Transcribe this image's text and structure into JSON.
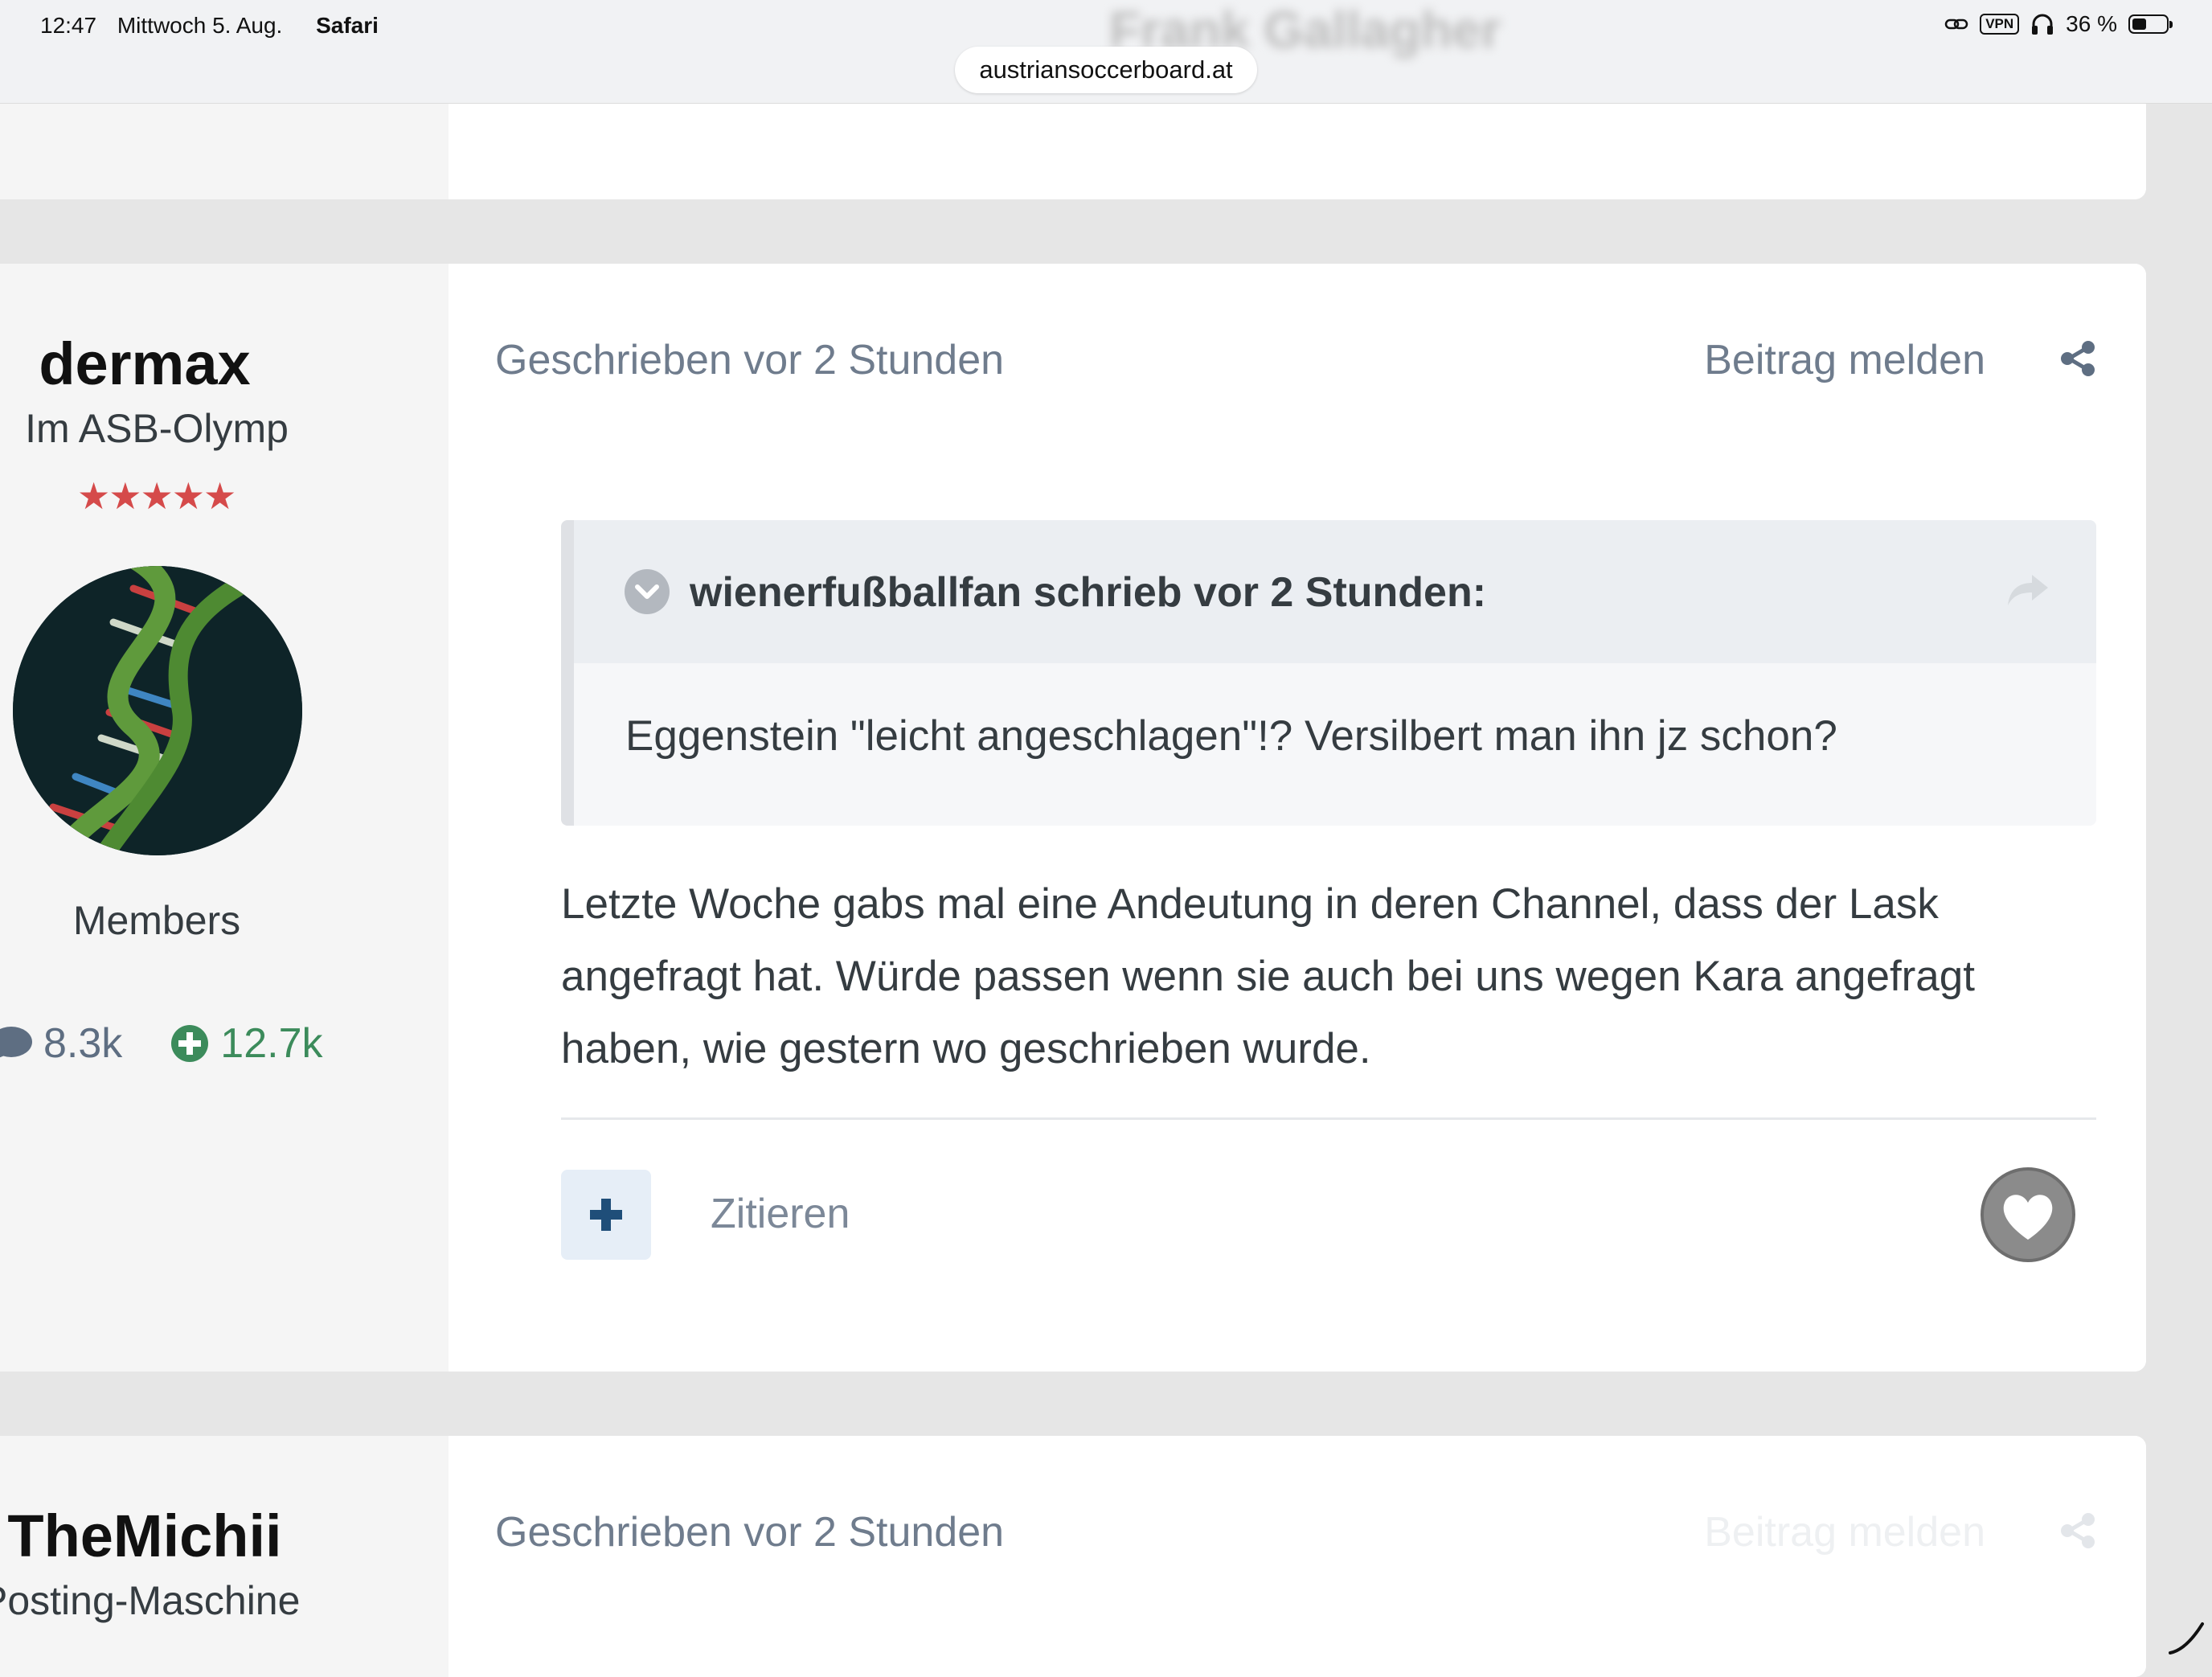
{
  "status_bar": {
    "time": "12:47",
    "date": "Mittwoch 5. Aug.",
    "app": "Safari",
    "vpn": "VPN",
    "battery": "36 %"
  },
  "browser": {
    "url": "austriansoccerboard.at",
    "ghost_title": "Frank Gallagher"
  },
  "posts": [
    {
      "author": {
        "name": "dermax",
        "rank": "Im ASB-Olymp",
        "stars": "★★★★★",
        "group": "Members",
        "posts_count": "8.3k",
        "reputation": "12.7k"
      },
      "meta": "Geschrieben vor 2 Stunden",
      "report": "Beitrag melden",
      "quote": {
        "cite": "wienerfußballfan schrieb vor 2 Stunden:",
        "text": "Eggenstein \"leicht angeschlagen\"!? Versilbert man ihn jz schon?"
      },
      "body_lines": [
        "Letzte Woche gabs mal eine Andeutung in deren Channel, dass der Lask",
        "angefragt hat. Würde passen wenn sie auch bei uns wegen Kara angefragt",
        "haben, wie gestern wo geschrieben wurde."
      ],
      "actions": {
        "quote_label": "Zitieren"
      }
    },
    {
      "author": {
        "name": "TheMichii",
        "rank": "Posting-Maschine"
      },
      "meta": "Geschrieben vor 2 Stunden",
      "report": "Beitrag melden"
    }
  ],
  "colors": {
    "accent_blue": "#1f4e79",
    "meta_gray": "#6f7c8d",
    "reputation_green": "#3c8b5b",
    "star_red": "#d54a4a"
  }
}
